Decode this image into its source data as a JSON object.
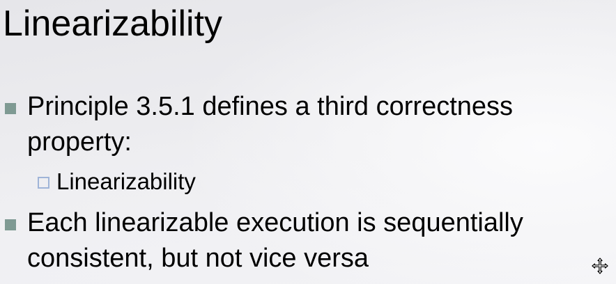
{
  "slide": {
    "title": "Linearizability",
    "bullets": [
      {
        "text": "Principle 3.5.1 defines a third correctness property:"
      },
      {
        "text": "Each linearizable execution is sequentially consistent, but not vice versa"
      }
    ],
    "sub_bullets": [
      {
        "text": "Linearizability"
      }
    ],
    "colors": {
      "bullet_marker": "#7f9a93",
      "sub_bullet_marker": "#9fb4d8"
    }
  },
  "cursor": {
    "icon": "move-cursor-icon"
  }
}
